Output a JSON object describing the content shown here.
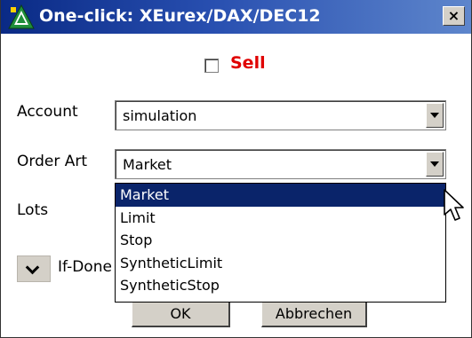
{
  "window": {
    "title": "One-click: XEurex/DAX/DEC12",
    "close_label": "×"
  },
  "sell": {
    "label": "Sell",
    "checked": false,
    "color": "#e00000"
  },
  "account": {
    "label": "Account",
    "value": "simulation"
  },
  "order_art": {
    "label": "Order Art",
    "value": "Market",
    "options": [
      "Market",
      "Limit",
      "Stop",
      "SyntheticLimit",
      "SyntheticStop"
    ],
    "highlighted": "Market"
  },
  "lots": {
    "label": "Lots"
  },
  "if_done": {
    "label": "If-Done"
  },
  "buttons": {
    "ok": "OK",
    "cancel": "Abbrechen"
  },
  "colors": {
    "titlebar_start": "#0a2a85",
    "titlebar_end": "#5e86cc",
    "highlight": "#0a246a"
  }
}
